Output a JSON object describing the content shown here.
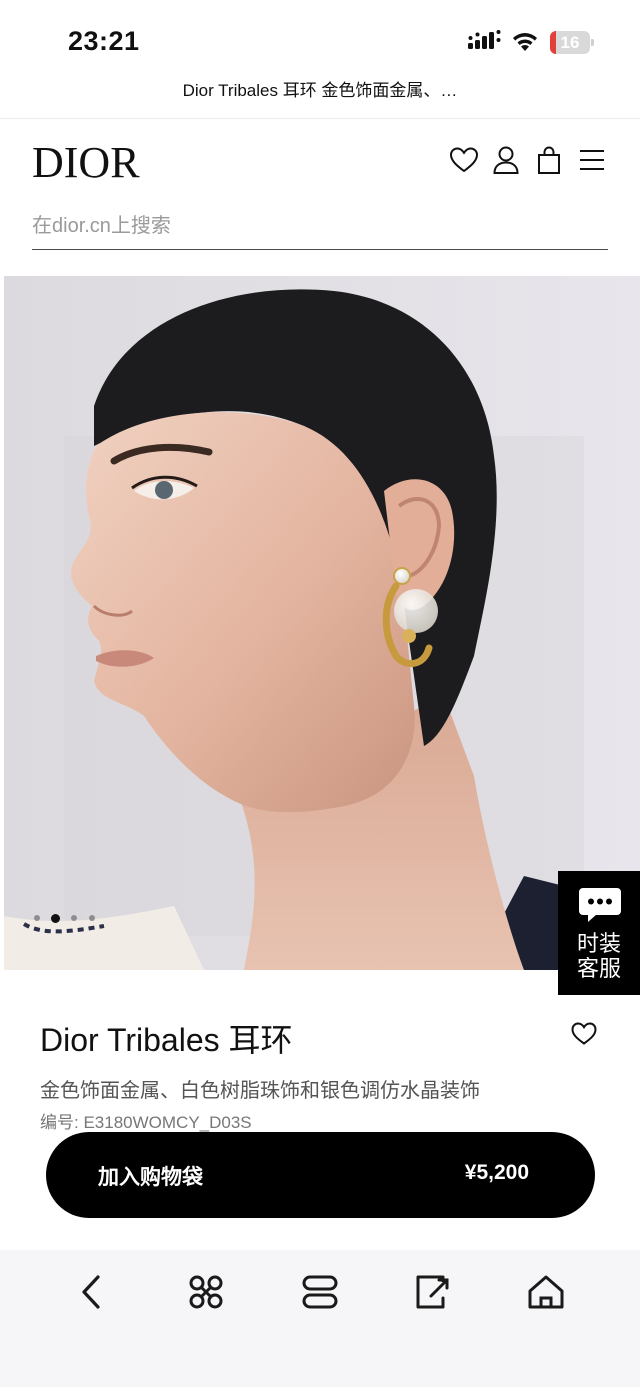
{
  "status_bar": {
    "time": "23:21",
    "battery_level": "16",
    "battery_color": "#e0413a",
    "icons": [
      "signal-icon",
      "wifi-icon",
      "battery-icon"
    ]
  },
  "browser": {
    "page_title": "Dior Tribales 耳环 金色饰面金属、…"
  },
  "header": {
    "logo": "DIOR",
    "icons": [
      "heart-icon",
      "account-icon",
      "shopping-bag-icon",
      "menu-icon"
    ]
  },
  "search": {
    "placeholder": "在dior.cn上搜索",
    "value": ""
  },
  "hero": {
    "image_alt": "model-wearing-earring",
    "slide_count": 4,
    "active_slide": 2
  },
  "chat": {
    "label": "时装客服",
    "icon": "chat-bubble-icon"
  },
  "product": {
    "name": "Dior Tribales 耳环",
    "description": "金色饰面金属、白色树脂珠饰和银色调仿水晶装饰",
    "ref_label": "编号: ",
    "ref_value": "E3180WOMCY_D03S",
    "wishlist_icon": "heart-icon"
  },
  "cta": {
    "label": "加入购物袋",
    "price": "¥5,200"
  },
  "browser_nav": {
    "icons": [
      "back-icon",
      "shortcuts-icon",
      "tabs-icon",
      "share-icon",
      "home-icon"
    ]
  },
  "colors": {
    "brand": "#111111",
    "cta_background": "#000000",
    "cta_text": "#ffffff"
  }
}
